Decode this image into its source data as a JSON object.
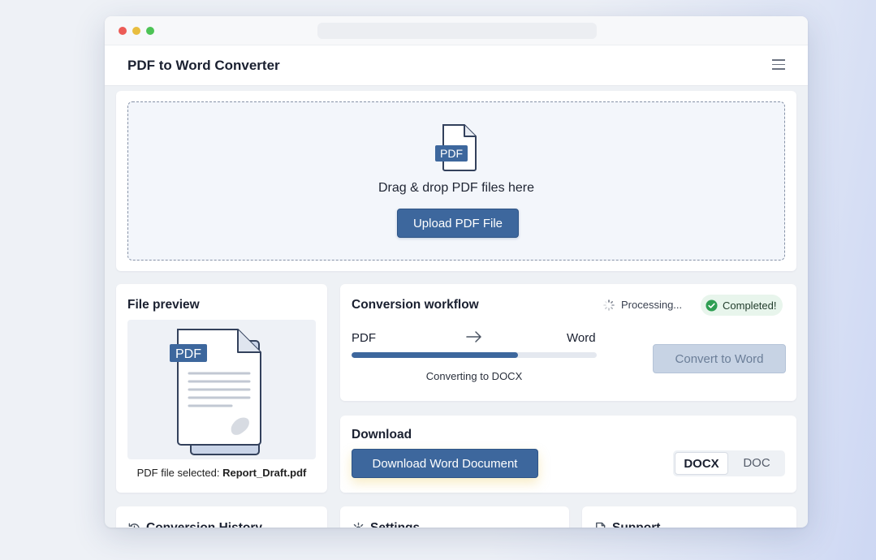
{
  "app": {
    "title": "PDF to Word Converter"
  },
  "upload": {
    "icon_label": "PDF",
    "drag_text": "Drag & drop PDF files here",
    "button_label": "Upload PDF File"
  },
  "preview": {
    "title": "File preview",
    "icon_label": "PDF",
    "caption_prefix": "PDF file selected:",
    "file_name": "Report_Draft.pdf"
  },
  "workflow": {
    "title": "Conversion workflow",
    "status_processing": "Processing...",
    "status_completed": "Completed!",
    "from_label": "PDF",
    "to_label": "Word",
    "progress_fraction": 0.68,
    "progress_text": "Converting to DOCX",
    "convert_button": "Convert to Word"
  },
  "download": {
    "title": "Download",
    "button_label": "Download Word Document",
    "formats": [
      "DOCX",
      "DOC"
    ],
    "selected_format": "DOCX"
  },
  "bottom_cards": [
    {
      "label": "Conversion History",
      "icon": "history-icon"
    },
    {
      "label": "Settings",
      "icon": "gear-icon"
    },
    {
      "label": "Support",
      "icon": "support-doc-icon"
    }
  ],
  "colors": {
    "accent": "#3d679d",
    "success": "#2e9e52",
    "disabled_button": "#c7d3e4"
  }
}
